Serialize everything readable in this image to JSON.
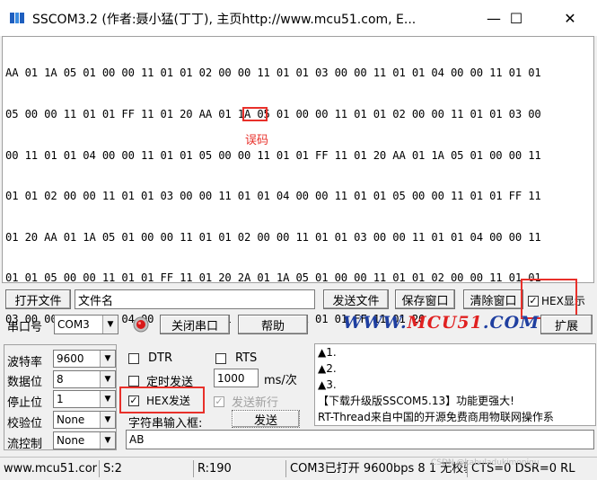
{
  "window": {
    "title": "SSCOM3.2 (作者:聂小猛(丁丁), 主页http://www.mcu51.com,  E...",
    "minimize_glyph": "—",
    "maximize_glyph": "☐",
    "close_glyph": "✕"
  },
  "receive": {
    "lines": [
      "AA 01 1A 05 01 00 00 11 01 01 02 00 00 11 01 01 03 00 00 11 01 01 04 00 00 11 01 01",
      "05 00 00 11 01 01 FF 11 01 20 AA 01 1A 05 01 00 00 11 01 01 02 00 00 11 01 01 03 00",
      "00 11 01 01 04 00 00 11 01 01 05 00 00 11 01 01 FF 11 01 20 AA 01 1A 05 01 00 00 11",
      "01 01 02 00 00 11 01 01 03 00 00 11 01 01 04 00 00 11 01 01 05 00 00 11 01 01 FF 11",
      "01 20 AA 01 1A 05 01 00 00 11 01 01 02 00 00 11 01 01 03 00 00 11 01 01 04 00 00 11",
      "01 01 05 00 00 11 01 01 FF 11 01 20 2A 01 1A 05 01 00 00 11 01 01 02 00 00 11 01 01",
      "03 00 00 11 01 01 04 00 00 11 01 01 05 00 00 11 01 01 FF 11 01 20"
    ],
    "error_label": "误码"
  },
  "row1": {
    "open_file": "打开文件",
    "filename": "文件名",
    "send_file": "发送文件",
    "save_window": "保存窗口",
    "clear_window": "清除窗口",
    "hex_display": "HEX显示"
  },
  "row2": {
    "port_label": "串口号",
    "port_value": "COM3",
    "close_port": "关闭串口",
    "help": "帮助",
    "logo_a": "WWW.",
    "logo_b": "MCU51",
    "logo_c": ".COM",
    "expand": "扩展"
  },
  "settings": {
    "baud_label": "波特率",
    "baud_value": "9600",
    "databits_label": "数据位",
    "databits_value": "8",
    "stopbits_label": "停止位",
    "stopbits_value": "1",
    "parity_label": "校验位",
    "parity_value": "None",
    "flow_label": "流控制",
    "flow_value": "None"
  },
  "controls": {
    "dtr": "DTR",
    "rts": "RTS",
    "timed_send": "定时发送",
    "interval": "1000",
    "interval_unit": "ms/次",
    "hex_send": "HEX发送",
    "send_newline": "发送新行",
    "input_label": "字符串输入框:",
    "send_button": "发送",
    "input_value": "AB"
  },
  "messages": {
    "line1": "▲1.",
    "line2": "▲2.",
    "line3": "▲3.",
    "line4": "【下载升级版SSCOM5.13】功能更强大!",
    "line5": "RT-Thread来自中国的开源免费商用物联网操作系"
  },
  "status": {
    "site": "www.mcu51.cor",
    "sent": "S:2",
    "received": "R:190",
    "port_state": "COM3已打开  9600bps  8  1  无校验",
    "signals": "CTS=0 DSR=0 RL",
    "watermark": "CSDN @kabuladukimonigu"
  },
  "colors": {
    "highlight": "#e8302a",
    "logo_blue": "#1f3fa0",
    "logo_red": "#e02020"
  }
}
